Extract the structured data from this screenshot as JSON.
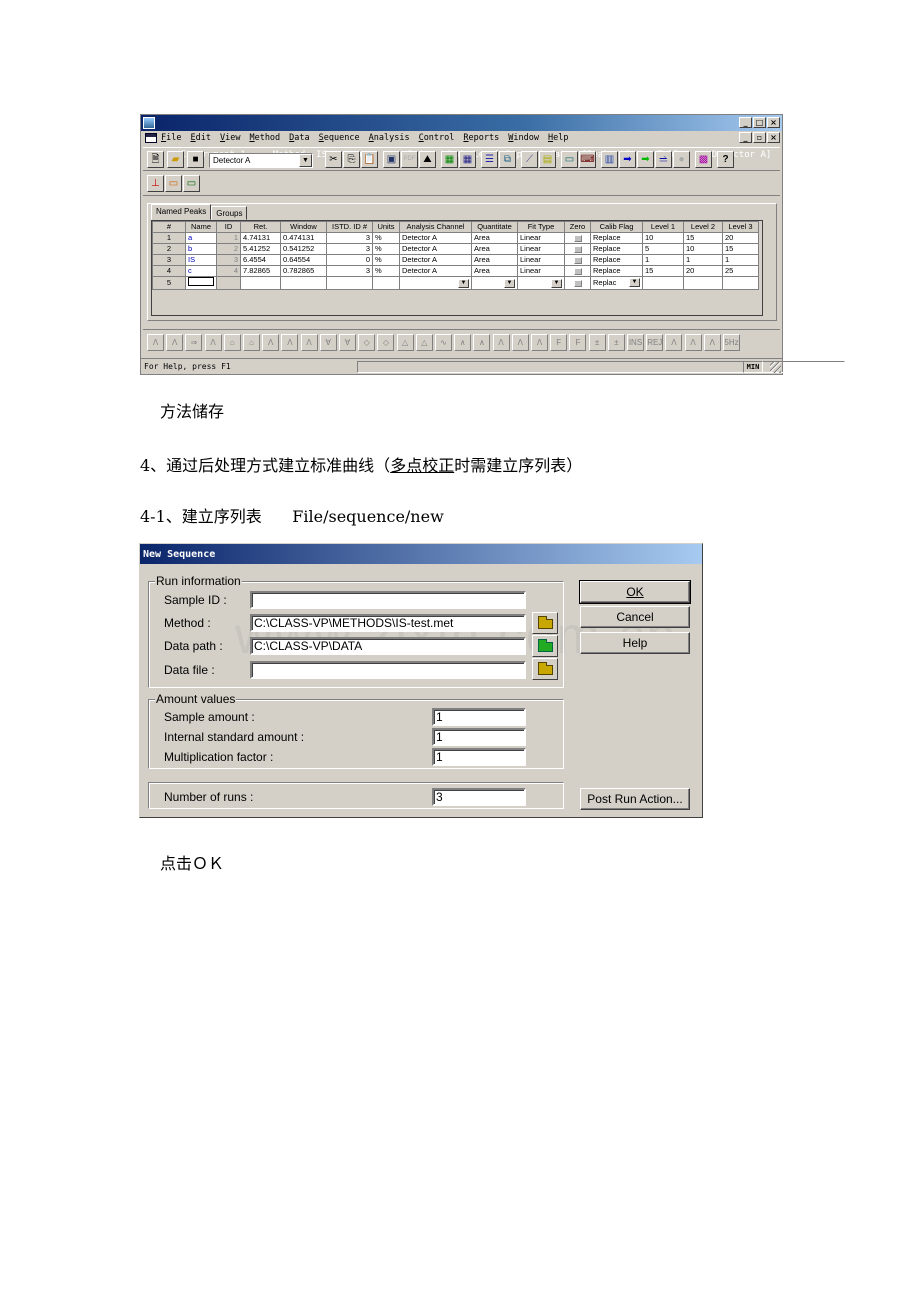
{
  "app_window": {
    "title_parts": [
      "Instrument 1",
      "Method: IS-test.met",
      "Data: LC-UV_Level_3_pac-1.dat - [Peak / Group Tables -- Detector A]"
    ],
    "title": "Instrument 1     Method: IS-test.met      Data: LC-UV_Level_3_pac-1.dat - [Peak / Group Tables -- Detector A]",
    "window_buttons": [
      "_",
      "□",
      "×"
    ],
    "mdi_buttons": [
      "_",
      "▫",
      "×"
    ],
    "menu": [
      "File",
      "Edit",
      "View",
      "Method",
      "Data",
      "Sequence",
      "Analysis",
      "Control",
      "Reports",
      "Window",
      "Help"
    ],
    "toolbar": {
      "detector_select": "Detector A",
      "buttons": [
        "new-icon",
        "open-icon",
        "save-icon",
        "cut-icon",
        "copy-icon",
        "paste-icon",
        "monitor-icon",
        "pdf-icon",
        "image-icon",
        "table-green-icon",
        "table-blue-icon",
        "list-icon",
        "copy-window-icon",
        "chart-icon",
        "report-icon",
        "calculator-icon",
        "keyboard-icon",
        "plot-icon",
        "arrow-right-icon",
        "double-arrow-icon",
        "sequence-icon",
        "stop-icon",
        "grid-icon",
        "help-icon"
      ]
    },
    "toolbar2": [
      "baseline-icon",
      "instrument-icon",
      "device-icon"
    ],
    "tabs": [
      {
        "label": "Named Peaks",
        "active": true
      },
      {
        "label": "Groups",
        "active": false
      }
    ],
    "peak_table": {
      "columns": [
        "#",
        "Name",
        "ID",
        "Ret.",
        "Window",
        "ISTD. ID #",
        "Units",
        "Analysis Channel",
        "Quantitate",
        "Fit Type",
        "Zero",
        "Calib Flag",
        "Level 1",
        "Level 2",
        "Level 3"
      ],
      "rows": [
        {
          "num": "1",
          "name": "a",
          "id": "1",
          "ret": "4.74131",
          "window": "0.474131",
          "istd": "3",
          "units": "%",
          "channel": "Detector A",
          "quant": "Area",
          "fit": "Linear",
          "calib": "Replace",
          "l1": "10",
          "l2": "15",
          "l3": "20"
        },
        {
          "num": "2",
          "name": "b",
          "id": "2",
          "ret": "5.41252",
          "window": "0.541252",
          "istd": "3",
          "units": "%",
          "channel": "Detector A",
          "quant": "Area",
          "fit": "Linear",
          "calib": "Replace",
          "l1": "5",
          "l2": "10",
          "l3": "15"
        },
        {
          "num": "3",
          "name": "IS",
          "id": "3",
          "ret": "6.4554",
          "window": "0.64554",
          "istd": "0",
          "units": "%",
          "channel": "Detector A",
          "quant": "Area",
          "fit": "Linear",
          "calib": "Replace",
          "l1": "1",
          "l2": "1",
          "l3": "1"
        },
        {
          "num": "4",
          "name": "c",
          "id": "4",
          "ret": "7.82865",
          "window": "0.782865",
          "istd": "3",
          "units": "%",
          "channel": "Detector A",
          "quant": "Area",
          "fit": "Linear",
          "calib": "Replace",
          "l1": "15",
          "l2": "20",
          "l3": "25"
        },
        {
          "num": "5",
          "name": "",
          "id": "",
          "ret": "",
          "window": "",
          "istd": "",
          "units": "",
          "channel": "",
          "quant": "",
          "fit": "",
          "calib": "Replac",
          "l1": "",
          "l2": "",
          "l3": ""
        }
      ]
    },
    "peak_toolbar": [
      "Λ",
      "Λ",
      "⇒",
      "Λ",
      "⌂",
      "⌂",
      "Λ",
      "Λ",
      "Λ",
      "∀",
      "∀",
      "◇",
      "◇",
      "△",
      "△",
      "∿",
      "∧",
      "∧",
      "Λ",
      "Λ",
      "Λ",
      "F",
      "F",
      "±",
      "±",
      "INS",
      "REJ",
      "Λ",
      "Λ",
      "Λ",
      "5Hz"
    ],
    "status": {
      "help": "For Help, press F1",
      "indicator": "MIN"
    }
  },
  "doc": {
    "line1": "方法储存",
    "line2_pre": "4、通过后处理方式建立标准曲线（",
    "line2_underlined": "多点校正",
    "line2_post": "时需建立序列表）",
    "line3": "4-1、建立序列表      File/sequence/new",
    "line4": "点击ＯＫ"
  },
  "dialog": {
    "title": "New Sequence",
    "run_info": {
      "group_label": "Run information",
      "sample_id_label": "Sample ID :",
      "sample_id_value": "",
      "method_label": "Method :",
      "method_value": "C:\\CLASS-VP\\METHODS\\IS-test.met",
      "data_path_label": "Data path :",
      "data_path_value": "C:\\CLASS-VP\\DATA",
      "data_file_label": "Data file :",
      "data_file_value": ""
    },
    "amounts": {
      "group_label": "Amount values",
      "sample_amount_label": "Sample amount :",
      "sample_amount_value": "1",
      "istd_amount_label": "Internal standard amount :",
      "istd_amount_value": "1",
      "mult_factor_label": "Multiplication factor :",
      "mult_factor_value": "1"
    },
    "runs": {
      "label": "Number of runs :",
      "value": "3"
    },
    "buttons": {
      "ok": "OK",
      "cancel": "Cancel",
      "help": "Help",
      "post_run": "Post Run Action..."
    },
    "watermark": "www.zixin.com.cn"
  }
}
